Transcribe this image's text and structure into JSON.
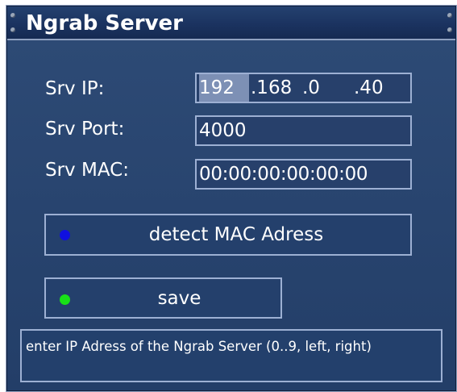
{
  "window": {
    "title": "Ngrab Server"
  },
  "form": {
    "ip_label": "Srv IP:",
    "ip_octets": [
      "192",
      ".168",
      ".0",
      ".40"
    ],
    "port_label": "Srv Port:",
    "port_value": "4000",
    "mac_label": "Srv MAC:",
    "mac_value": "00:00:00:00:00:00"
  },
  "buttons": {
    "detect_label": "detect MAC Adress",
    "detect_color": "#1010e0",
    "save_label": "save",
    "save_color": "#18e018"
  },
  "status": {
    "text": "enter IP Adress of the Ngrab Server (0..9, left, right)"
  }
}
